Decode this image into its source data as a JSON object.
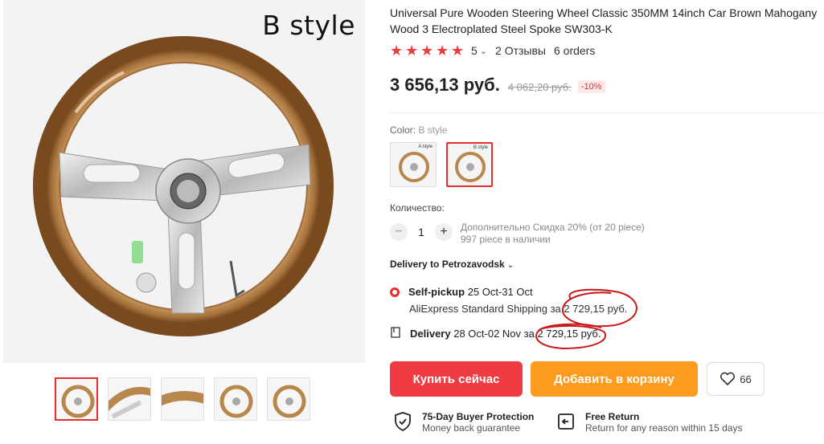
{
  "gallery": {
    "main_label": "B style",
    "thumbnail_count": 5
  },
  "product": {
    "title": "Universal Pure Wooden Steering Wheel Classic 350MM 14inch Car Brown Mahogany Wood 3 Electroplated Steel Spoke SW303-K",
    "rating_value": "5",
    "reviews": "2 Отзывы",
    "orders": "6 orders",
    "stars": 5
  },
  "price": {
    "current": "3 656,13 руб.",
    "old": "4 062,20 руб.",
    "discount": "-10%"
  },
  "color": {
    "label": "Color:",
    "value": "B style",
    "swatch_a_label": "A style",
    "swatch_b_label": "B style"
  },
  "quantity": {
    "label": "Количество:",
    "value": "1",
    "bulk_info": "Дополнительно Скидка 20% (от 20 piece)",
    "stock": "997 piece в наличии"
  },
  "delivery": {
    "to_label": "Delivery to Petrozavodsk",
    "pickup_title": "Self-pickup",
    "pickup_dates": "25 Oct-31 Oct",
    "pickup_sub": "AliExpress Standard Shipping за 2 729,15 руб.",
    "delivery_title": "Delivery",
    "delivery_dates": "28 Oct-02 Nov за 2 729,15 руб."
  },
  "actions": {
    "buy": "Купить сейчас",
    "cart": "Добавить в корзину",
    "wishlist_count": "66"
  },
  "features": {
    "protection_title": "75-Day Buyer Protection",
    "protection_sub": "Money back guarantee",
    "return_title": "Free Return",
    "return_sub": "Return for any reason within 15 days"
  },
  "colors": {
    "accent": "#e62e2e",
    "buy": "#ef3b43",
    "cart": "#fd9b1e",
    "wood": "#b9864c"
  }
}
